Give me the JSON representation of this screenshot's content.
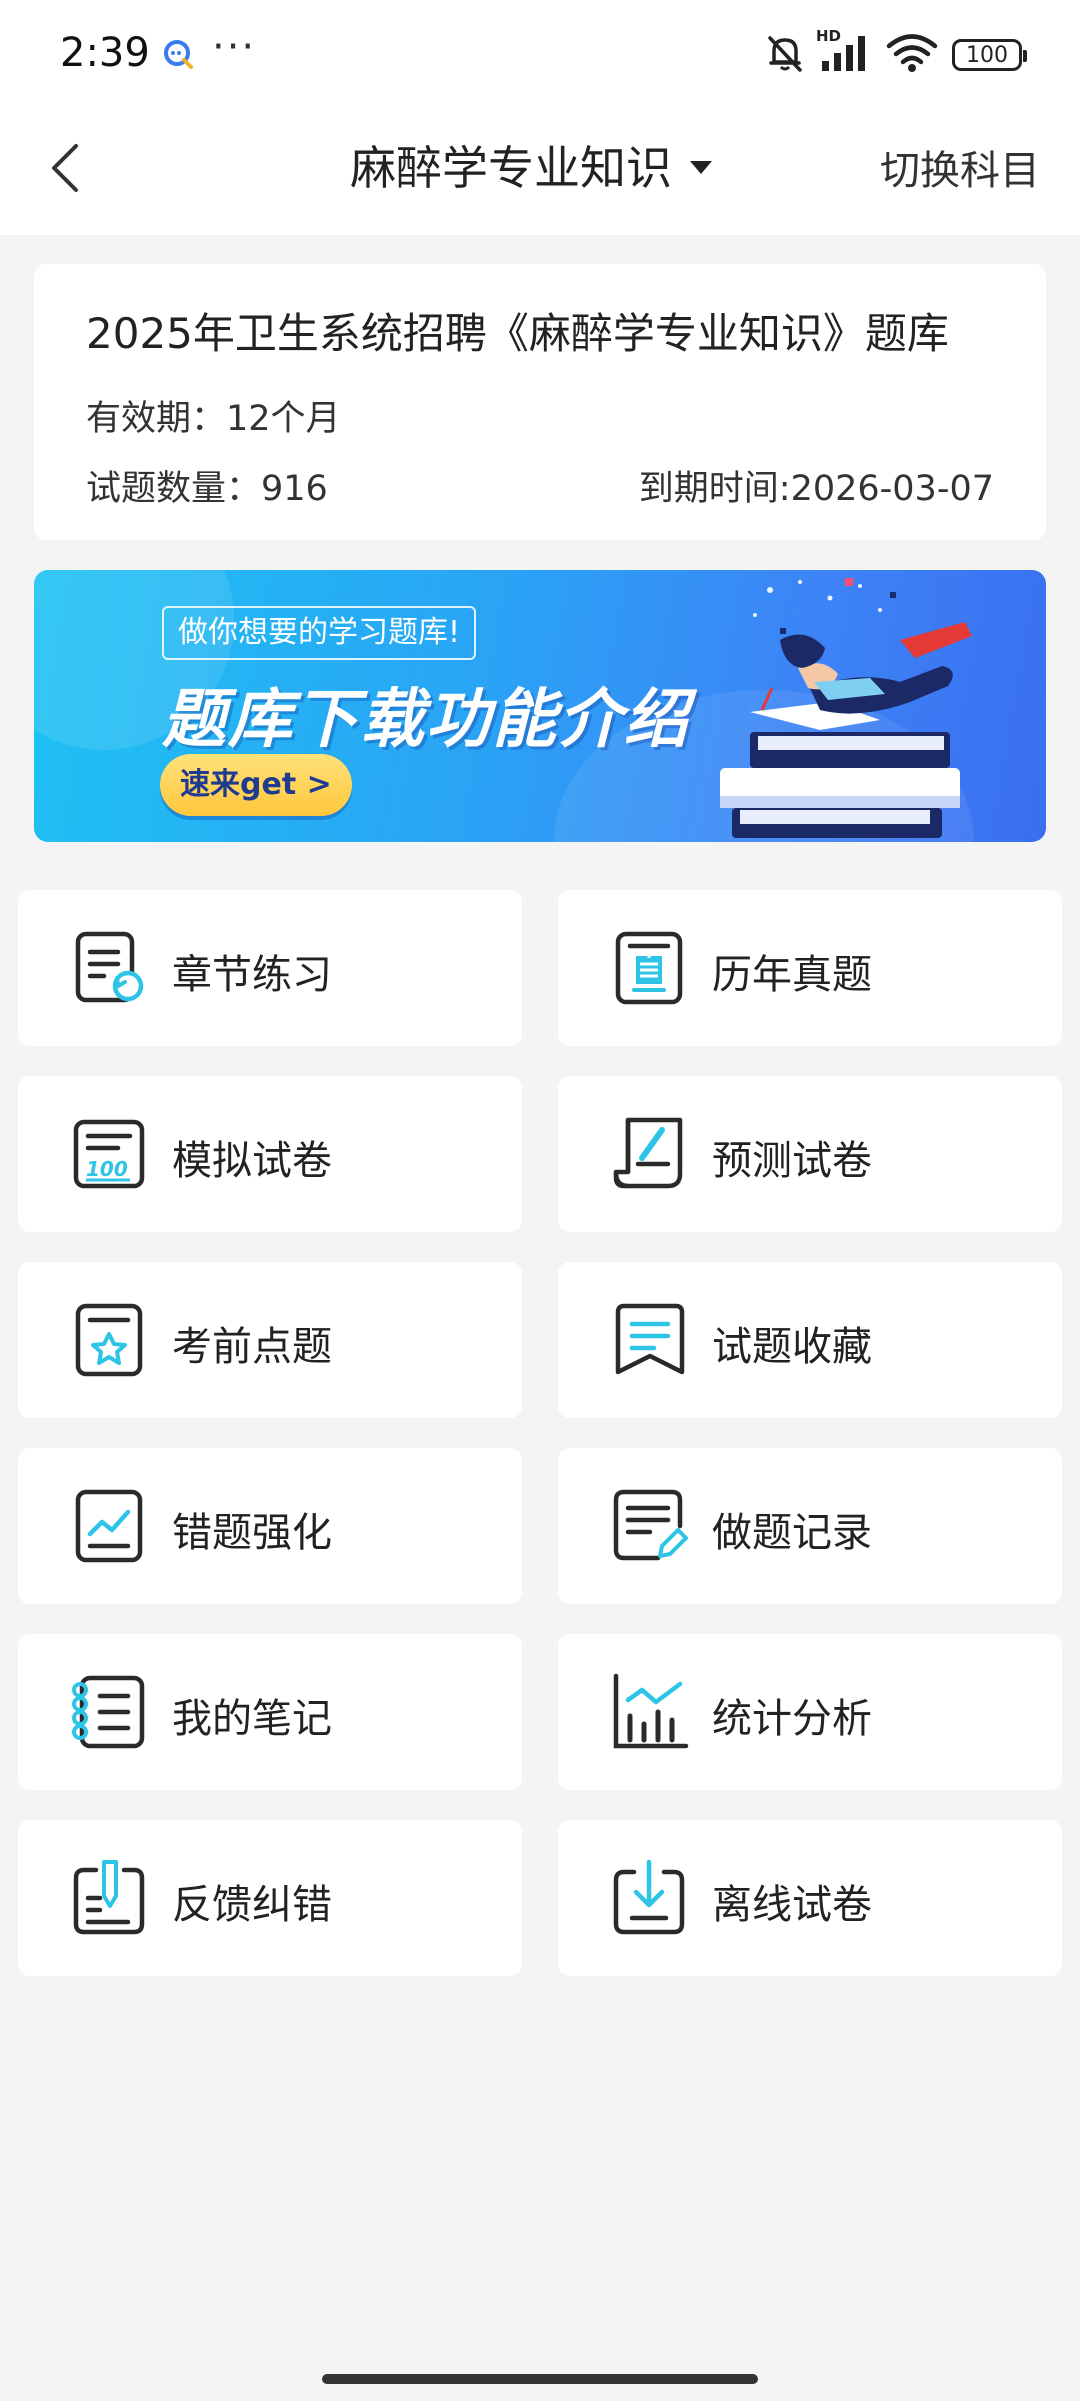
{
  "status_bar": {
    "time": "2:39",
    "dots": "···",
    "hd_label": "HD",
    "battery": "100"
  },
  "nav": {
    "title": "麻醉学专业知识",
    "switch_label": "切换科目"
  },
  "info": {
    "title": "2025年卫生系统招聘《麻醉学专业知识》题库",
    "validity": "有效期：12个月",
    "question_count": "试题数量：916",
    "expire": "到期时间:2026-03-07"
  },
  "banner": {
    "tag": "做你想要的学习题库!",
    "headline": "题库下载功能介绍",
    "cta": "速来get >"
  },
  "menu": [
    {
      "label": "章节练习",
      "icon": "chapter-practice-icon"
    },
    {
      "label": "历年真题",
      "icon": "past-exams-icon"
    },
    {
      "label": "模拟试卷",
      "icon": "mock-exam-icon"
    },
    {
      "label": "预测试卷",
      "icon": "prediction-exam-icon"
    },
    {
      "label": "考前点题",
      "icon": "pre-exam-tips-icon"
    },
    {
      "label": "试题收藏",
      "icon": "favorites-icon"
    },
    {
      "label": "错题强化",
      "icon": "wrong-questions-icon"
    },
    {
      "label": "做题记录",
      "icon": "practice-record-icon"
    },
    {
      "label": "我的笔记",
      "icon": "notes-icon"
    },
    {
      "label": "统计分析",
      "icon": "statistics-icon"
    },
    {
      "label": "反馈纠错",
      "icon": "feedback-icon"
    },
    {
      "label": "离线试卷",
      "icon": "offline-exam-icon"
    }
  ],
  "colors": {
    "accent": "#2ec4e6",
    "icon_dark": "#2a2a2a",
    "background": "#f4f4f5",
    "banner_start": "#1ec2f3",
    "banner_end": "#3a6ff0"
  }
}
